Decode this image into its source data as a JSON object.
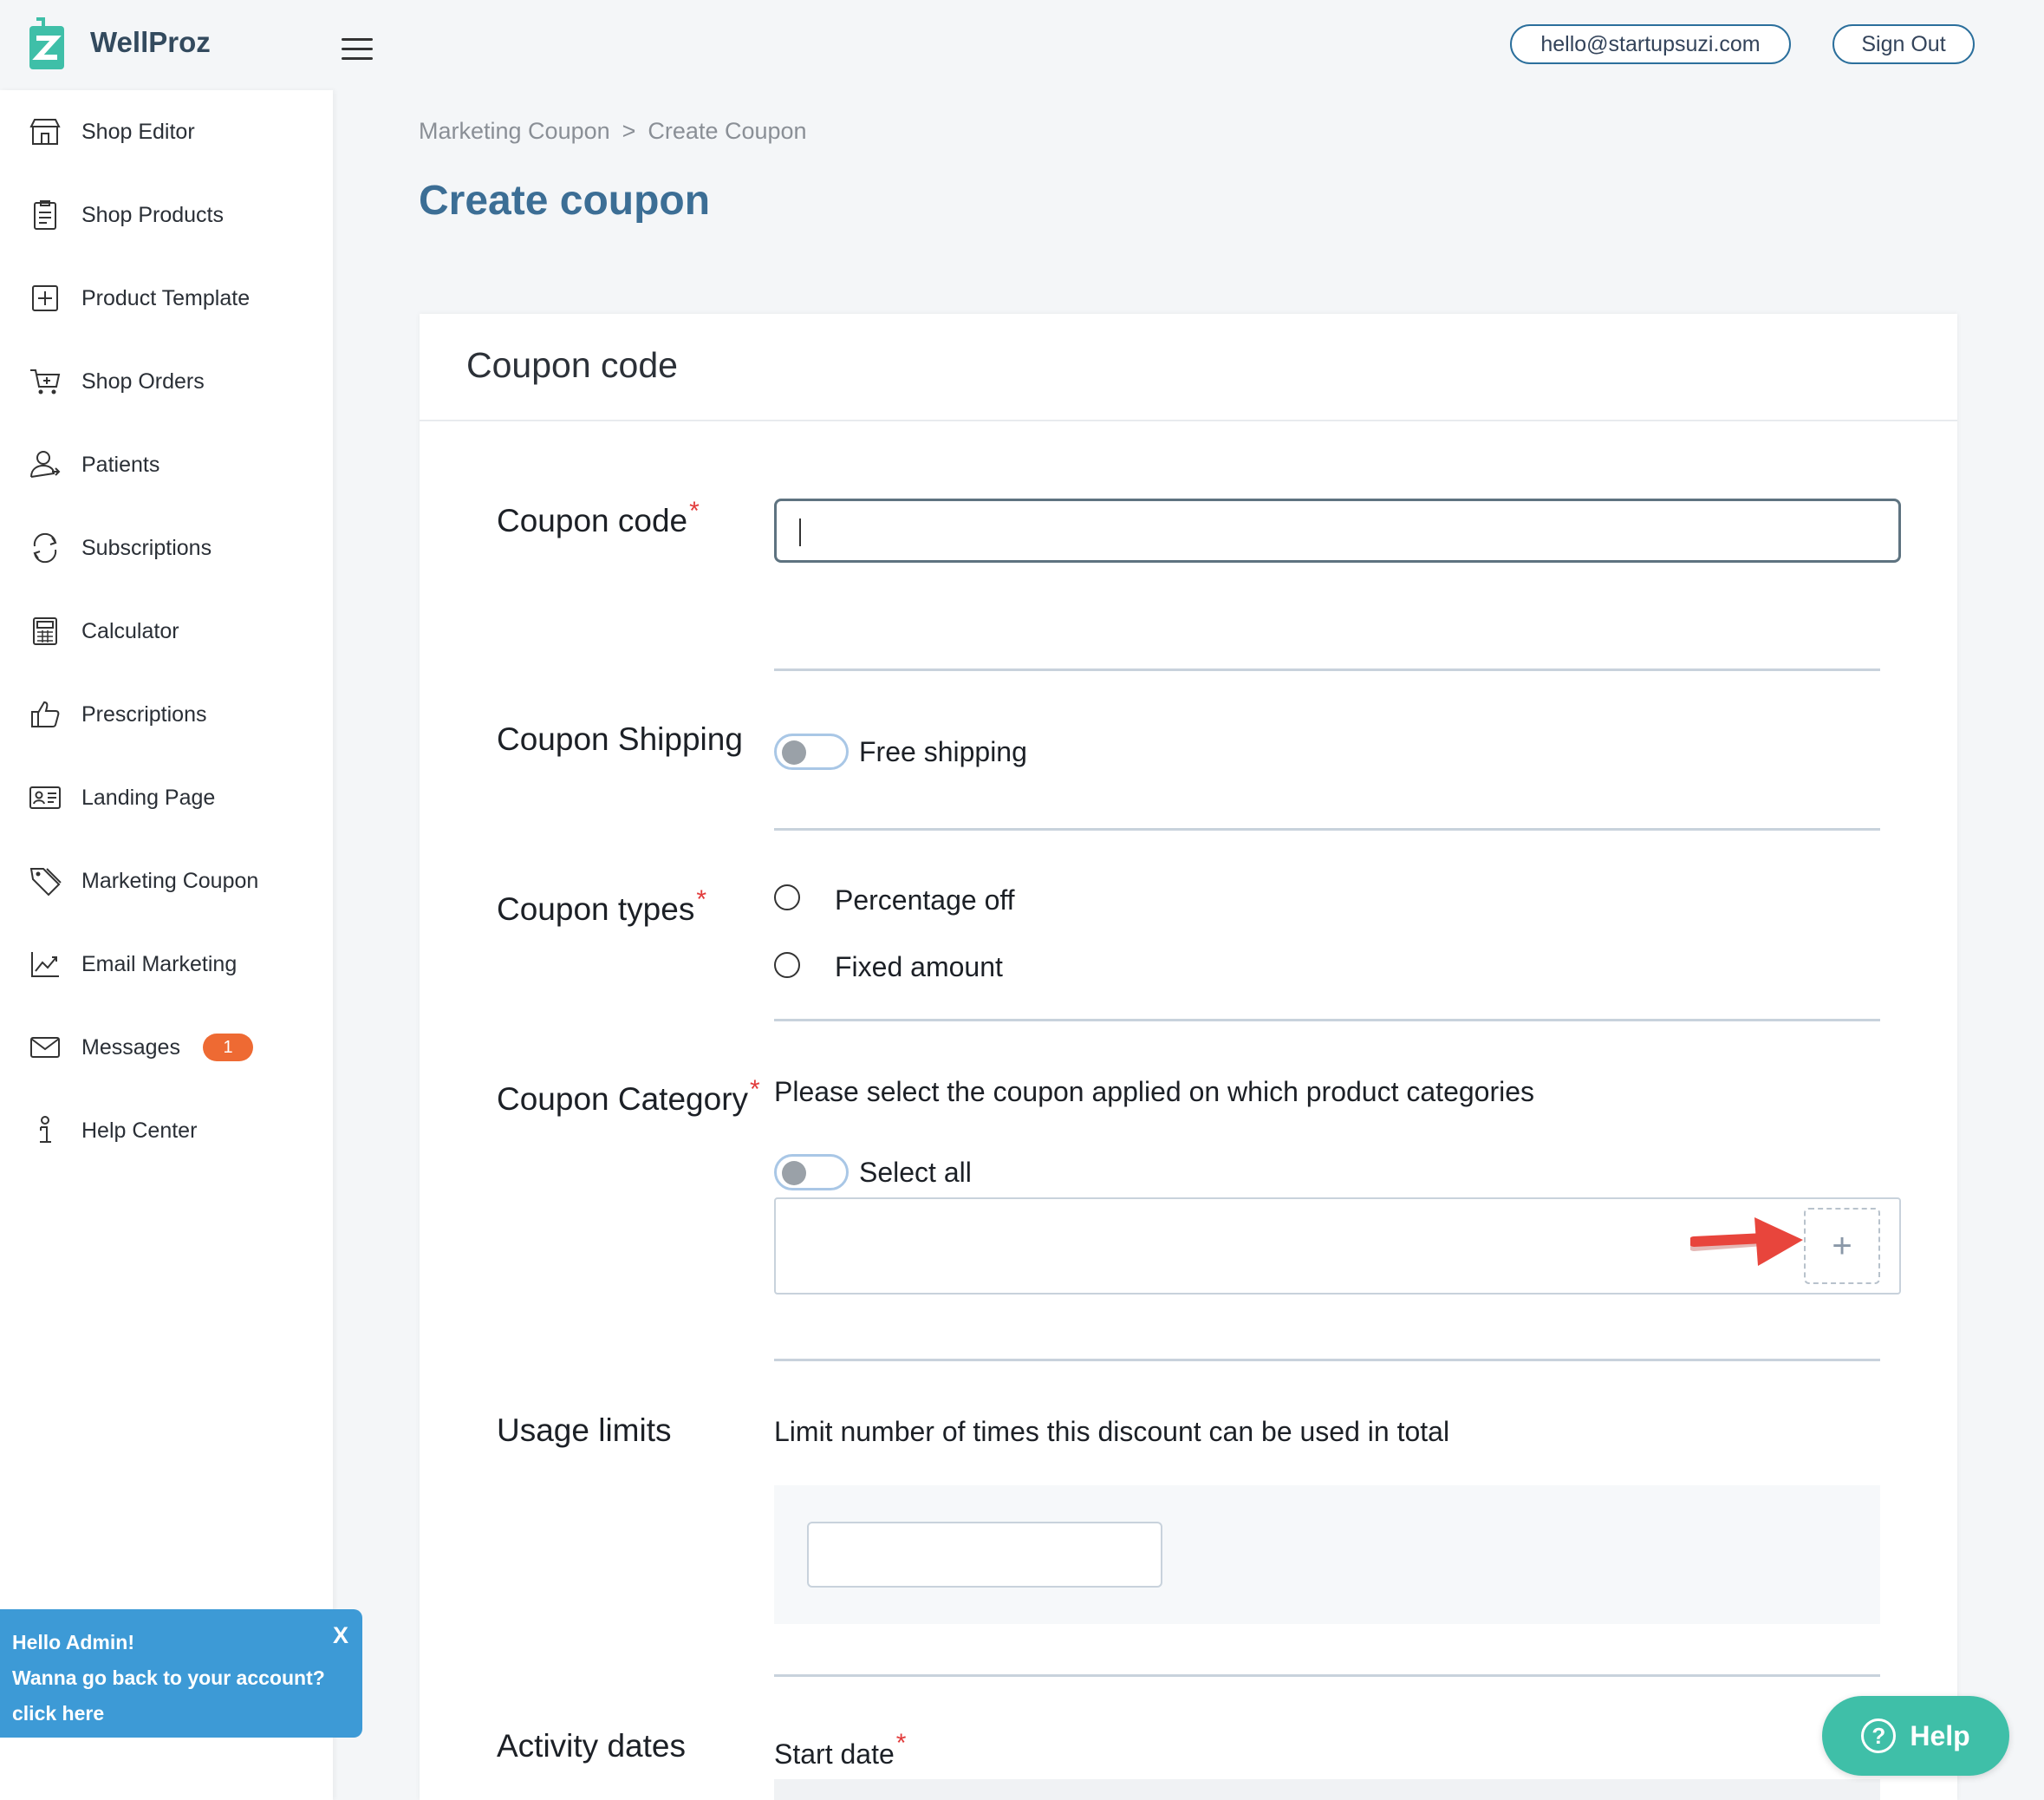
{
  "brand": {
    "name": "WellProz"
  },
  "header": {
    "email": "hello@startupsuzi.com",
    "signout": "Sign Out"
  },
  "sidebar": {
    "items": [
      {
        "label": "Shop Editor",
        "icon": "store-icon"
      },
      {
        "label": "Shop Products",
        "icon": "clipboard-icon"
      },
      {
        "label": "Product Template",
        "icon": "add-box-icon"
      },
      {
        "label": "Shop Orders",
        "icon": "cart-icon"
      },
      {
        "label": "Patients",
        "icon": "user-icon"
      },
      {
        "label": "Subscriptions",
        "icon": "refresh-icon"
      },
      {
        "label": "Calculator",
        "icon": "calculator-icon"
      },
      {
        "label": "Prescriptions",
        "icon": "thumbs-up-icon"
      },
      {
        "label": "Landing Page",
        "icon": "id-card-icon"
      },
      {
        "label": "Marketing Coupon",
        "icon": "tag-icon"
      },
      {
        "label": "Email Marketing",
        "icon": "chart-line-icon"
      },
      {
        "label": "Messages",
        "icon": "mail-icon",
        "badge": "1"
      },
      {
        "label": "Help Center",
        "icon": "info-icon"
      }
    ]
  },
  "admin_popup": {
    "line1": "Hello Admin!",
    "line2": "Wanna go back to your account?",
    "line3": "click here",
    "close": "X"
  },
  "breadcrumb": {
    "parent": "Marketing Coupon",
    "separator": ">",
    "current": "Create Coupon"
  },
  "page_title": "Create coupon",
  "card": {
    "title": "Coupon code",
    "coupon_code": {
      "label": "Coupon code",
      "required": "*",
      "value": ""
    },
    "shipping": {
      "label": "Coupon Shipping",
      "toggle_label": "Free shipping"
    },
    "types": {
      "label": "Coupon types",
      "required": "*",
      "options": [
        "Percentage off",
        "Fixed amount"
      ]
    },
    "category": {
      "label": "Coupon Category",
      "required": "*",
      "description": "Please select the coupon applied on which product categories",
      "select_all": "Select all",
      "add_symbol": "+"
    },
    "usage": {
      "label": "Usage limits",
      "description": "Limit number of times this discount can be used in total",
      "value": ""
    },
    "activity": {
      "label": "Activity dates",
      "start_label": "Start date",
      "required": "*"
    }
  },
  "help_button": {
    "label": "Help",
    "symbol": "?"
  },
  "colors": {
    "accent": "#3c6e95",
    "help": "#3fbfa8",
    "popup": "#3d9ad6",
    "badge": "#ee6a33",
    "arrow": "#e8453c"
  }
}
